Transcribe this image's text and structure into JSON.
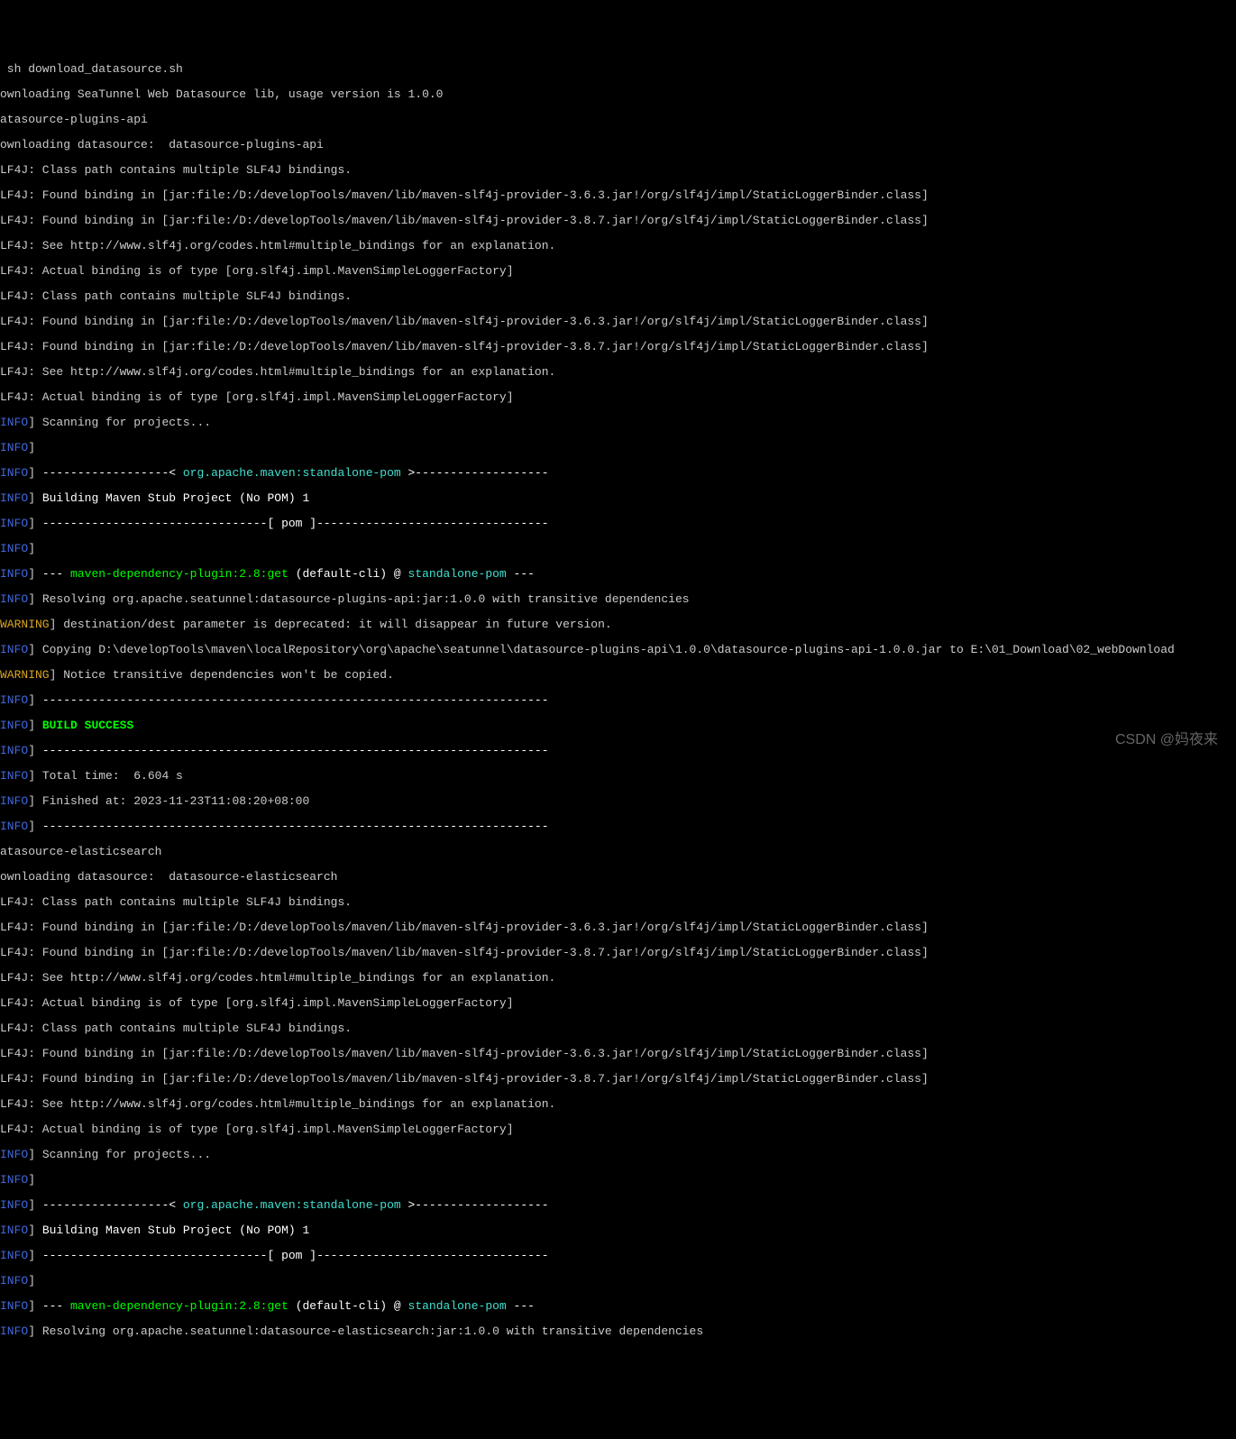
{
  "cmd": " sh download_datasource.sh",
  "lines": {
    "l01": "ownloading SeaTunnel Web Datasource lib, usage version is 1.0.0",
    "l02": "atasource-plugins-api",
    "l03": "ownloading datasource:  datasource-plugins-api",
    "slf4j_multiple": "LF4J: Class path contains multiple SLF4J bindings.",
    "slf4j_363": "LF4J: Found binding in [jar:file:/D:/developTools/maven/lib/maven-slf4j-provider-3.6.3.jar!/org/slf4j/impl/StaticLoggerBinder.class]",
    "slf4j_387": "LF4J: Found binding in [jar:file:/D:/developTools/maven/lib/maven-slf4j-provider-3.8.7.jar!/org/slf4j/impl/StaticLoggerBinder.class]",
    "slf4j_see": "LF4J: See http://www.slf4j.org/codes.html#multiple_bindings for an explanation.",
    "slf4j_actual": "LF4J: Actual binding is of type [org.slf4j.impl.MavenSimpleLoggerFactory]",
    "info_tag": "INFO",
    "warn_tag": "WARNING",
    "bracket": "]",
    "scanning": " Scanning for projects...",
    "empty": "",
    "sep_left": " ------------------< ",
    "standalone_pom_fq": "org.apache.maven:standalone-pom",
    "sep_right": " >-------------------",
    "building": " Building Maven Stub Project (No POM) 1",
    "pom_line": " --------------------------------[ pom ]---------------------------------",
    "dash3": " --- ",
    "plugin": "maven-dependency-plugin:2.8:get",
    "default_cli": " (default-cli) @ ",
    "standalone_pom": "standalone-pom",
    "dash3_end": " ---",
    "resolving1": " Resolving org.apache.seatunnel:datasource-plugins-api:jar:1.0.0 with transitive dependencies",
    "warn_dest": "] destination/dest parameter is deprecated: it will disappear in future version.",
    "copying": " Copying D:\\developTools\\maven\\localRepository\\org\\apache\\seatunnel\\datasource-plugins-api\\1.0.0\\datasource-plugins-api-1.0.0.jar to E:\\01_Download\\02_webDownload",
    "warn_notice": "] Notice transitive dependencies won't be copied.",
    "hr": " ------------------------------------------------------------------------",
    "build_success": " BUILD SUCCESS",
    "total_time": " Total time:  6.604 s",
    "finished_at": " Finished at: 2023-11-23T11:08:20+08:00",
    "l_es": "atasource-elasticsearch",
    "l_es_dl": "ownloading datasource:  datasource-elasticsearch",
    "resolving2": " Resolving org.apache.seatunnel:datasource-elasticsearch:jar:1.0.0 with transitive dependencies"
  },
  "watermark": "CSDN @妈夜来"
}
